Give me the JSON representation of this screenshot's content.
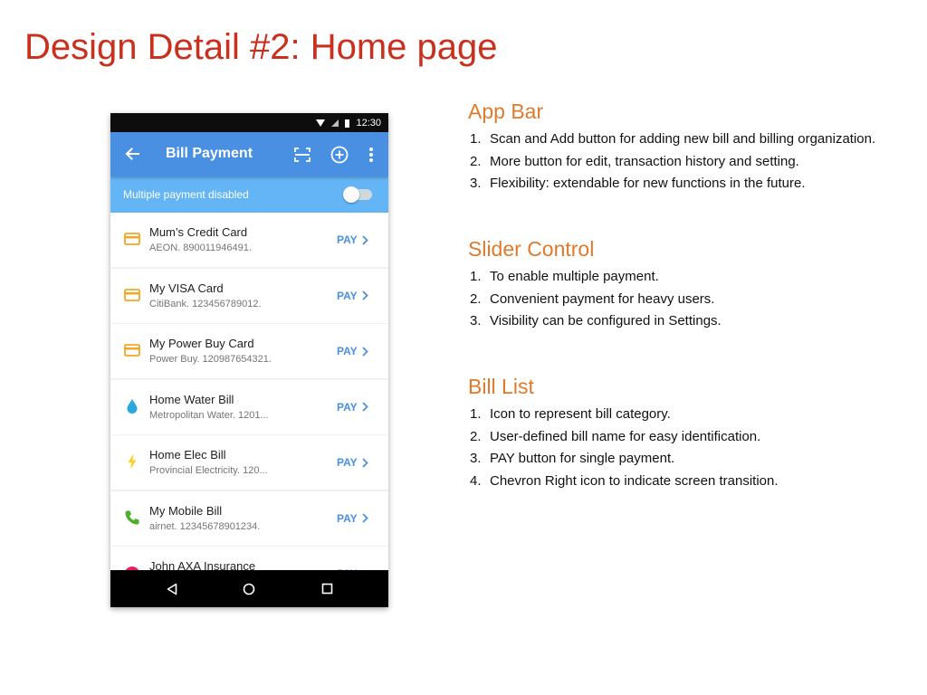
{
  "slide": {
    "title": "Design Detail #2: Home page"
  },
  "phone": {
    "status_bar": {
      "time": "12:30"
    },
    "app_bar": {
      "title": "Bill Payment",
      "color": "#4a90e2",
      "icons": [
        "back-arrow-icon",
        "scan-icon",
        "add-circle-icon",
        "more-vert-icon"
      ]
    },
    "toggle_bar": {
      "label": "Multiple payment disabled",
      "enabled": false,
      "color": "#64b5f6"
    },
    "pay_label": "PAY",
    "bills": [
      {
        "name": "Mum’s Credit Card",
        "detail": "AEON. 890011946491.",
        "icon": "credit-card-icon",
        "icon_color": "#f5a623"
      },
      {
        "name": "My VISA Card",
        "detail": "CitiBank. 123456789012.",
        "icon": "credit-card-icon",
        "icon_color": "#f5a623"
      },
      {
        "name": "My Power Buy Card",
        "detail": "Power Buy. 120987654321.",
        "icon": "credit-card-icon",
        "icon_color": "#f5a623"
      },
      {
        "name": "Home Water Bill",
        "detail": "Metropolitan Water. 1201...",
        "icon": "water-drop-icon",
        "icon_color": "#29a8e0"
      },
      {
        "name": "Home Elec Bill",
        "detail": "Provincial Electricity. 120...",
        "icon": "lightning-icon",
        "icon_color": "#f8d21c"
      },
      {
        "name": "My Mobile Bill",
        "detail": "airnet. 12345678901234.",
        "icon": "phone-icon",
        "icon_color": "#4caf2a"
      },
      {
        "name": "John AXA Insurance",
        "detail": "",
        "icon": "insurance-icon",
        "icon_color": "#e91e63"
      }
    ],
    "nav_icons": [
      "nav-back-icon",
      "nav-home-icon",
      "nav-recent-icon"
    ]
  },
  "sections": [
    {
      "heading": "App Bar",
      "items": [
        {
          "num": "1.",
          "text": "Scan and Add button for adding new bill and billing organization."
        },
        {
          "num": "2.",
          "text": "More button for edit, transaction history and setting."
        },
        {
          "num": "3.",
          "text": "Flexibility: extendable for new functions in the future."
        }
      ]
    },
    {
      "heading": "Slider Control",
      "items": [
        {
          "num": "1.",
          "text": "To enable multiple payment."
        },
        {
          "num": "2.",
          "text": "Convenient payment for heavy users."
        },
        {
          "num": "3.",
          "text": "Visibility can be configured in Settings."
        }
      ]
    },
    {
      "heading": "Bill List",
      "items": [
        {
          "num": "1.",
          "text": "Icon to represent bill category."
        },
        {
          "num": "2.",
          "text": "User-defined bill name for easy identification."
        },
        {
          "num": "3.",
          "text": "PAY button for single payment."
        },
        {
          "num": "4.",
          "text": "Chevron Right icon to indicate screen transition."
        }
      ]
    }
  ],
  "colors": {
    "title": "#c9301d",
    "section_heading": "#e07a2b",
    "accent": "#4a90e2"
  }
}
